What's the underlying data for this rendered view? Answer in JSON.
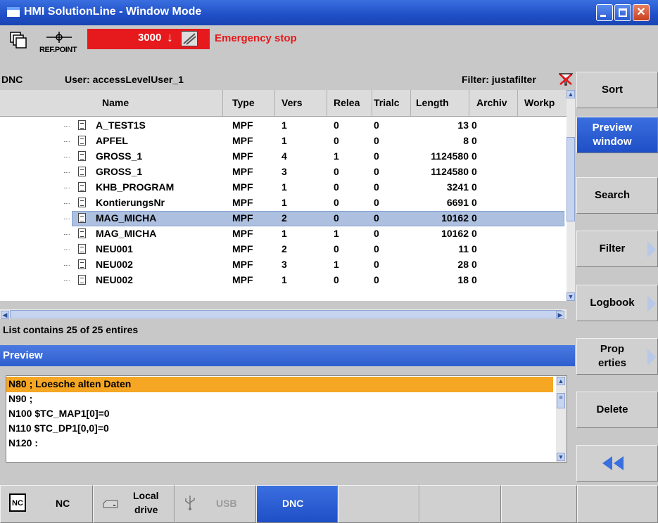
{
  "window": {
    "title": "HMI SolutionLine - Window Mode",
    "controls": [
      "minimize-icon",
      "maximize-icon",
      "close-icon"
    ],
    "close_glyph": "✕"
  },
  "status": {
    "refpoint_label": "REF.POINT",
    "alarm_number": "3000",
    "alarm_text": "Emergency stop",
    "alarm_color": "#e6191c"
  },
  "dnc": {
    "label": "DNC",
    "user": "User: accessLevelUser_1",
    "filter": "Filter: justafilter"
  },
  "table": {
    "columns": [
      "Name",
      "Type",
      "Vers",
      "Relea",
      "Trialc",
      "Length",
      "Archiv",
      "Workp"
    ],
    "rows": [
      {
        "name": "A_TEST1S",
        "type": "MPF",
        "vers": "1",
        "relea": "0",
        "trialc": "0",
        "length": "13",
        "archiv": "0"
      },
      {
        "name": "APFEL",
        "type": "MPF",
        "vers": "1",
        "relea": "0",
        "trialc": "0",
        "length": "8",
        "archiv": "0"
      },
      {
        "name": "GROSS_1",
        "type": "MPF",
        "vers": "4",
        "relea": "1",
        "trialc": "0",
        "length": "1124580",
        "archiv": "0"
      },
      {
        "name": "GROSS_1",
        "type": "MPF",
        "vers": "3",
        "relea": "0",
        "trialc": "0",
        "length": "1124580",
        "archiv": "0"
      },
      {
        "name": "KHB_PROGRAM",
        "type": "MPF",
        "vers": "1",
        "relea": "0",
        "trialc": "0",
        "length": "3241",
        "archiv": "0"
      },
      {
        "name": "KontierungsNr",
        "type": "MPF",
        "vers": "1",
        "relea": "0",
        "trialc": "0",
        "length": "6691",
        "archiv": "0"
      },
      {
        "name": "MAG_MICHA",
        "type": "MPF",
        "vers": "2",
        "relea": "0",
        "trialc": "0",
        "length": "10162",
        "archiv": "0"
      },
      {
        "name": "MAG_MICHA",
        "type": "MPF",
        "vers": "1",
        "relea": "1",
        "trialc": "0",
        "length": "10162",
        "archiv": "0"
      },
      {
        "name": "NEU001",
        "type": "MPF",
        "vers": "2",
        "relea": "0",
        "trialc": "0",
        "length": "11",
        "archiv": "0"
      },
      {
        "name": "NEU002",
        "type": "MPF",
        "vers": "3",
        "relea": "1",
        "trialc": "0",
        "length": "28",
        "archiv": "0"
      },
      {
        "name": "NEU002",
        "type": "MPF",
        "vers": "1",
        "relea": "0",
        "trialc": "0",
        "length": "18",
        "archiv": "0"
      }
    ],
    "selected_index": 6,
    "list_info": "List contains 25 of 25 entires"
  },
  "preview": {
    "title": "Preview",
    "lines": [
      "N80 ; Loesche alten Daten",
      "N90 ;",
      "N100 $TC_MAP1[0]=0",
      "N110 $TC_DP1[0,0]=0",
      "N120 :"
    ],
    "highlight_color": "#f5a623"
  },
  "softkeys_vertical": [
    {
      "label": "Sort",
      "active": false,
      "more": false
    },
    {
      "label": "Preview window",
      "line1": "Preview",
      "line2": "window",
      "active": true,
      "more": false
    },
    {
      "label": "Search",
      "active": false,
      "more": false
    },
    {
      "label": "Filter",
      "active": false,
      "more": true
    },
    {
      "label": "Logbook",
      "active": false,
      "more": true
    },
    {
      "label": "Prop erties",
      "line1": "Prop",
      "line2": "erties",
      "active": false,
      "more": true
    },
    {
      "label": "Delete",
      "active": false,
      "more": false
    },
    {
      "label": "back-icon",
      "active": false,
      "more": false
    }
  ],
  "softkeys_horizontal": [
    {
      "label": "NC",
      "icon": "nc-icon"
    },
    {
      "label": "Local drive",
      "line1": "Local",
      "line2": "drive",
      "icon": "drive-icon"
    },
    {
      "label": "USB",
      "icon": "usb-icon",
      "disabled": true
    },
    {
      "label": "DNC",
      "active": true
    },
    {
      "label": ""
    },
    {
      "label": ""
    },
    {
      "label": ""
    },
    {
      "label": ""
    }
  ]
}
